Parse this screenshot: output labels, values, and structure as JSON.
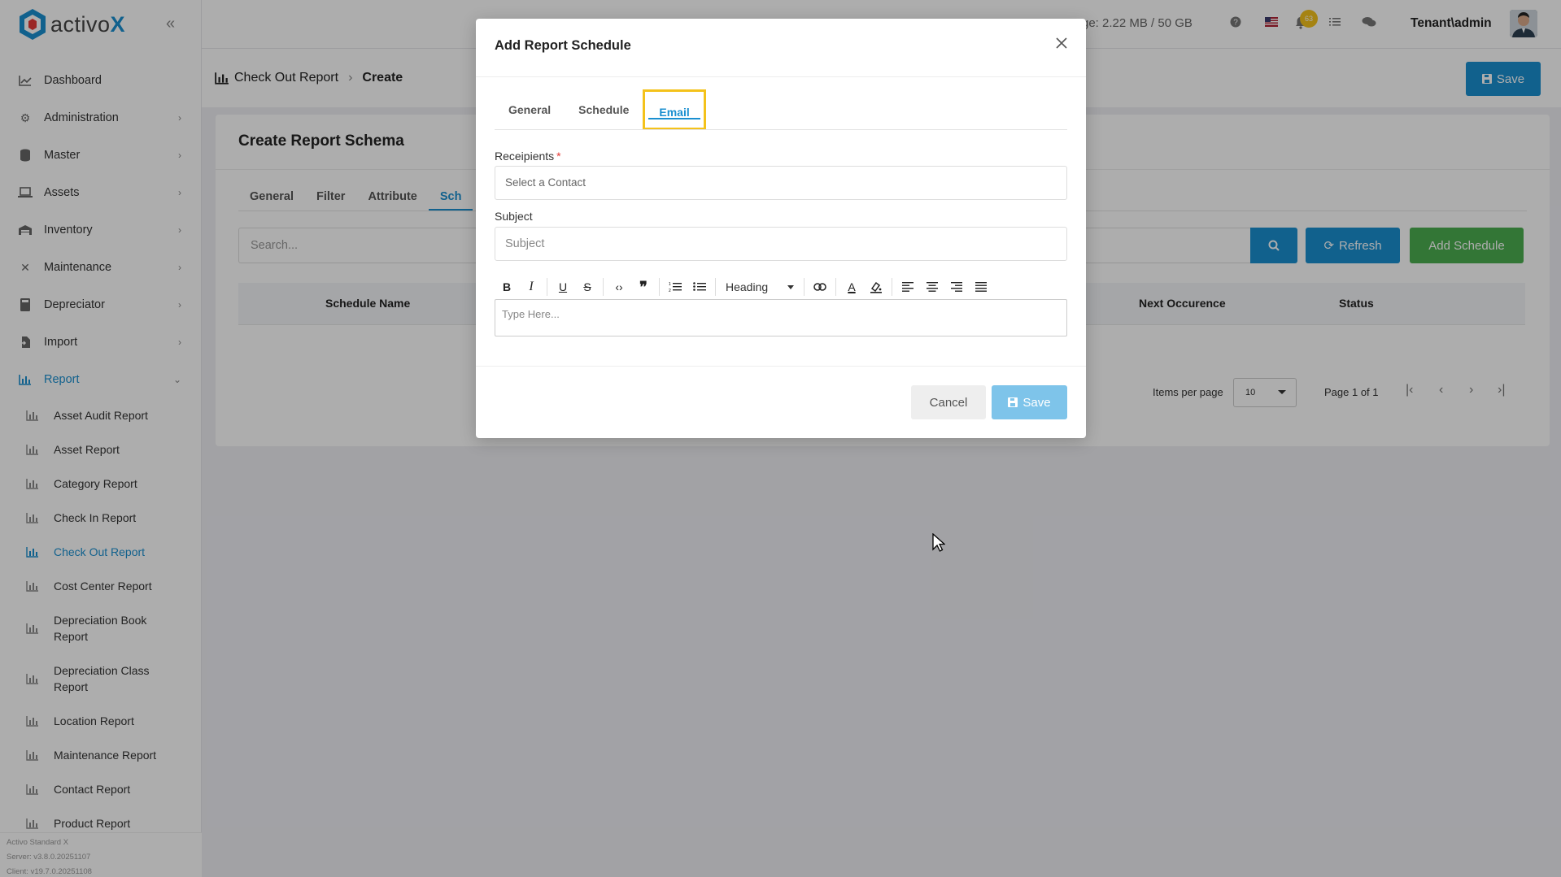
{
  "app": {
    "logo_prefix": "activo",
    "logo_suffix": "X"
  },
  "sidebar": {
    "items": [
      {
        "label": "Dashboard",
        "icon": "chart-line-icon"
      },
      {
        "label": "Administration",
        "icon": "gears-icon"
      },
      {
        "label": "Master",
        "icon": "database-icon"
      },
      {
        "label": "Assets",
        "icon": "laptop-icon"
      },
      {
        "label": "Inventory",
        "icon": "warehouse-icon"
      },
      {
        "label": "Maintenance",
        "icon": "tools-icon"
      },
      {
        "label": "Depreciator",
        "icon": "calculator-icon"
      },
      {
        "label": "Import",
        "icon": "file-import-icon"
      },
      {
        "label": "Report",
        "icon": "chart-bar-icon"
      }
    ],
    "report_sub": [
      "Asset Audit Report",
      "Asset Report",
      "Category Report",
      "Check In Report",
      "Check Out Report",
      "Cost Center Report",
      "Depreciation Book Report",
      "Depreciation Class Report",
      "Location Report",
      "Maintenance Report",
      "Contact Report",
      "Product Report"
    ],
    "version": {
      "product": "Activo Standard X",
      "server": "Server: v3.8.0.20251107",
      "client": "Client: v19.7.0.20251108"
    }
  },
  "topbar": {
    "storage": "ge: 2.22 MB / 50 GB",
    "notifications": "63",
    "user": "Tenant\\admin"
  },
  "breadcrumb": {
    "parent": "Check Out Report",
    "current": "Create",
    "save_label": "Save"
  },
  "card": {
    "title": "Create Report Schema",
    "tabs": [
      "General",
      "Filter",
      "Attribute",
      "Sch"
    ],
    "search_placeholder": "Search...",
    "refresh_label": "Refresh",
    "add_label": "Add Schedule",
    "columns": [
      "Schedule Name",
      "Next Occurence",
      "Status"
    ],
    "items_per_page_label": "Items per page",
    "items_per_page": "10",
    "page_info": "Page 1 of 1"
  },
  "modal": {
    "title": "Add Report Schedule",
    "tabs": [
      "General",
      "Schedule",
      "Email"
    ],
    "recipients_label": "Receipients",
    "recipients_required": "*",
    "recipients_placeholder": "Select a Contact",
    "subject_label": "Subject",
    "subject_placeholder": "Subject",
    "heading_label": "Heading",
    "editor_placeholder": "Type Here...",
    "cancel_label": "Cancel",
    "save_label": "Save"
  },
  "colors": {
    "primary": "#1a8fd0",
    "success": "#4caf50",
    "highlight": "#f4c21b"
  }
}
